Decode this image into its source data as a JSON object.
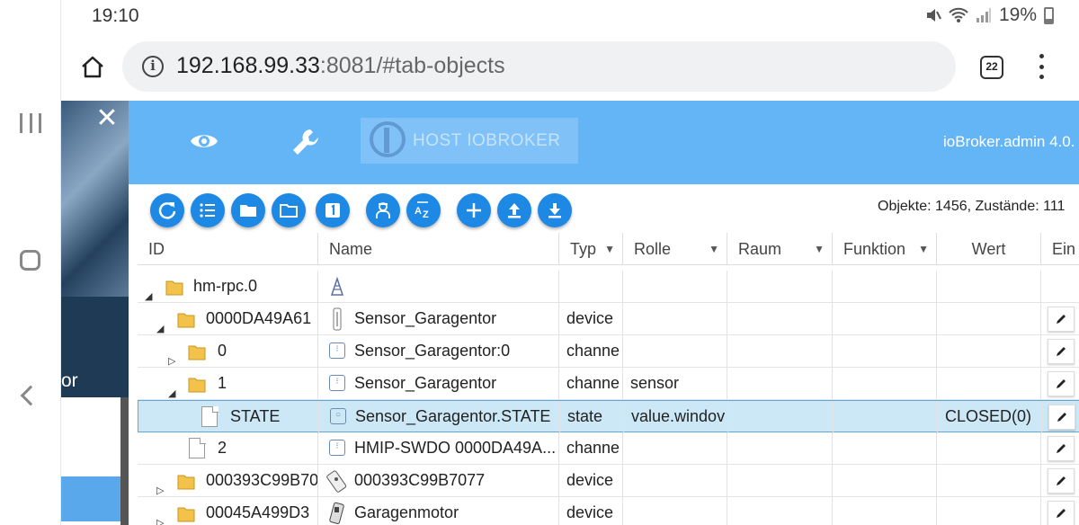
{
  "status": {
    "time": "19:10",
    "battery": "19%"
  },
  "browser": {
    "url_host": "192.168.99.33",
    "url_rest": ":8081/#tab-objects",
    "tab_count": "22"
  },
  "drawer": {
    "peek_text": "or"
  },
  "app": {
    "host_tab": "HOST IOBROKER",
    "version": "ioBroker.admin 4.0."
  },
  "toolbar": {
    "counts": "Objekte: 1456, Zustände: 111",
    "button_color": "#1e88e5"
  },
  "table": {
    "columns": [
      {
        "label": "ID"
      },
      {
        "label": "Name"
      },
      {
        "label": "Typ"
      },
      {
        "label": "Rolle"
      },
      {
        "label": "Raum"
      },
      {
        "label": "Funktion"
      },
      {
        "label": "Wert"
      },
      {
        "label": "Ein"
      }
    ],
    "rows": [
      {
        "id": "hm-rpc.0",
        "name": "",
        "type": "",
        "role": "",
        "value": ""
      },
      {
        "id": "0000DA49A61",
        "name": "Sensor_Garagentor",
        "type": "device",
        "role": "",
        "value": ""
      },
      {
        "id": "0",
        "name": "Sensor_Garagentor:0",
        "type": "channe",
        "role": "",
        "value": ""
      },
      {
        "id": "1",
        "name": "Sensor_Garagentor",
        "type": "channe",
        "role": "sensor",
        "value": ""
      },
      {
        "id": "STATE",
        "name": "Sensor_Garagentor.STATE",
        "type": "state",
        "role": "value.windov",
        "value": "CLOSED(0)"
      },
      {
        "id": "2",
        "name": "HMIP-SWDO 0000DA49A...",
        "type": "channe",
        "role": "",
        "value": ""
      },
      {
        "id": "000393C99B70",
        "name": "000393C99B7077",
        "type": "device",
        "role": "",
        "value": ""
      },
      {
        "id": "00045A499D3",
        "name": "Garagenmotor",
        "type": "device",
        "role": "",
        "value": ""
      }
    ]
  },
  "colors": {
    "header": "#64b5f6",
    "selected_row": "#cce8f6"
  }
}
